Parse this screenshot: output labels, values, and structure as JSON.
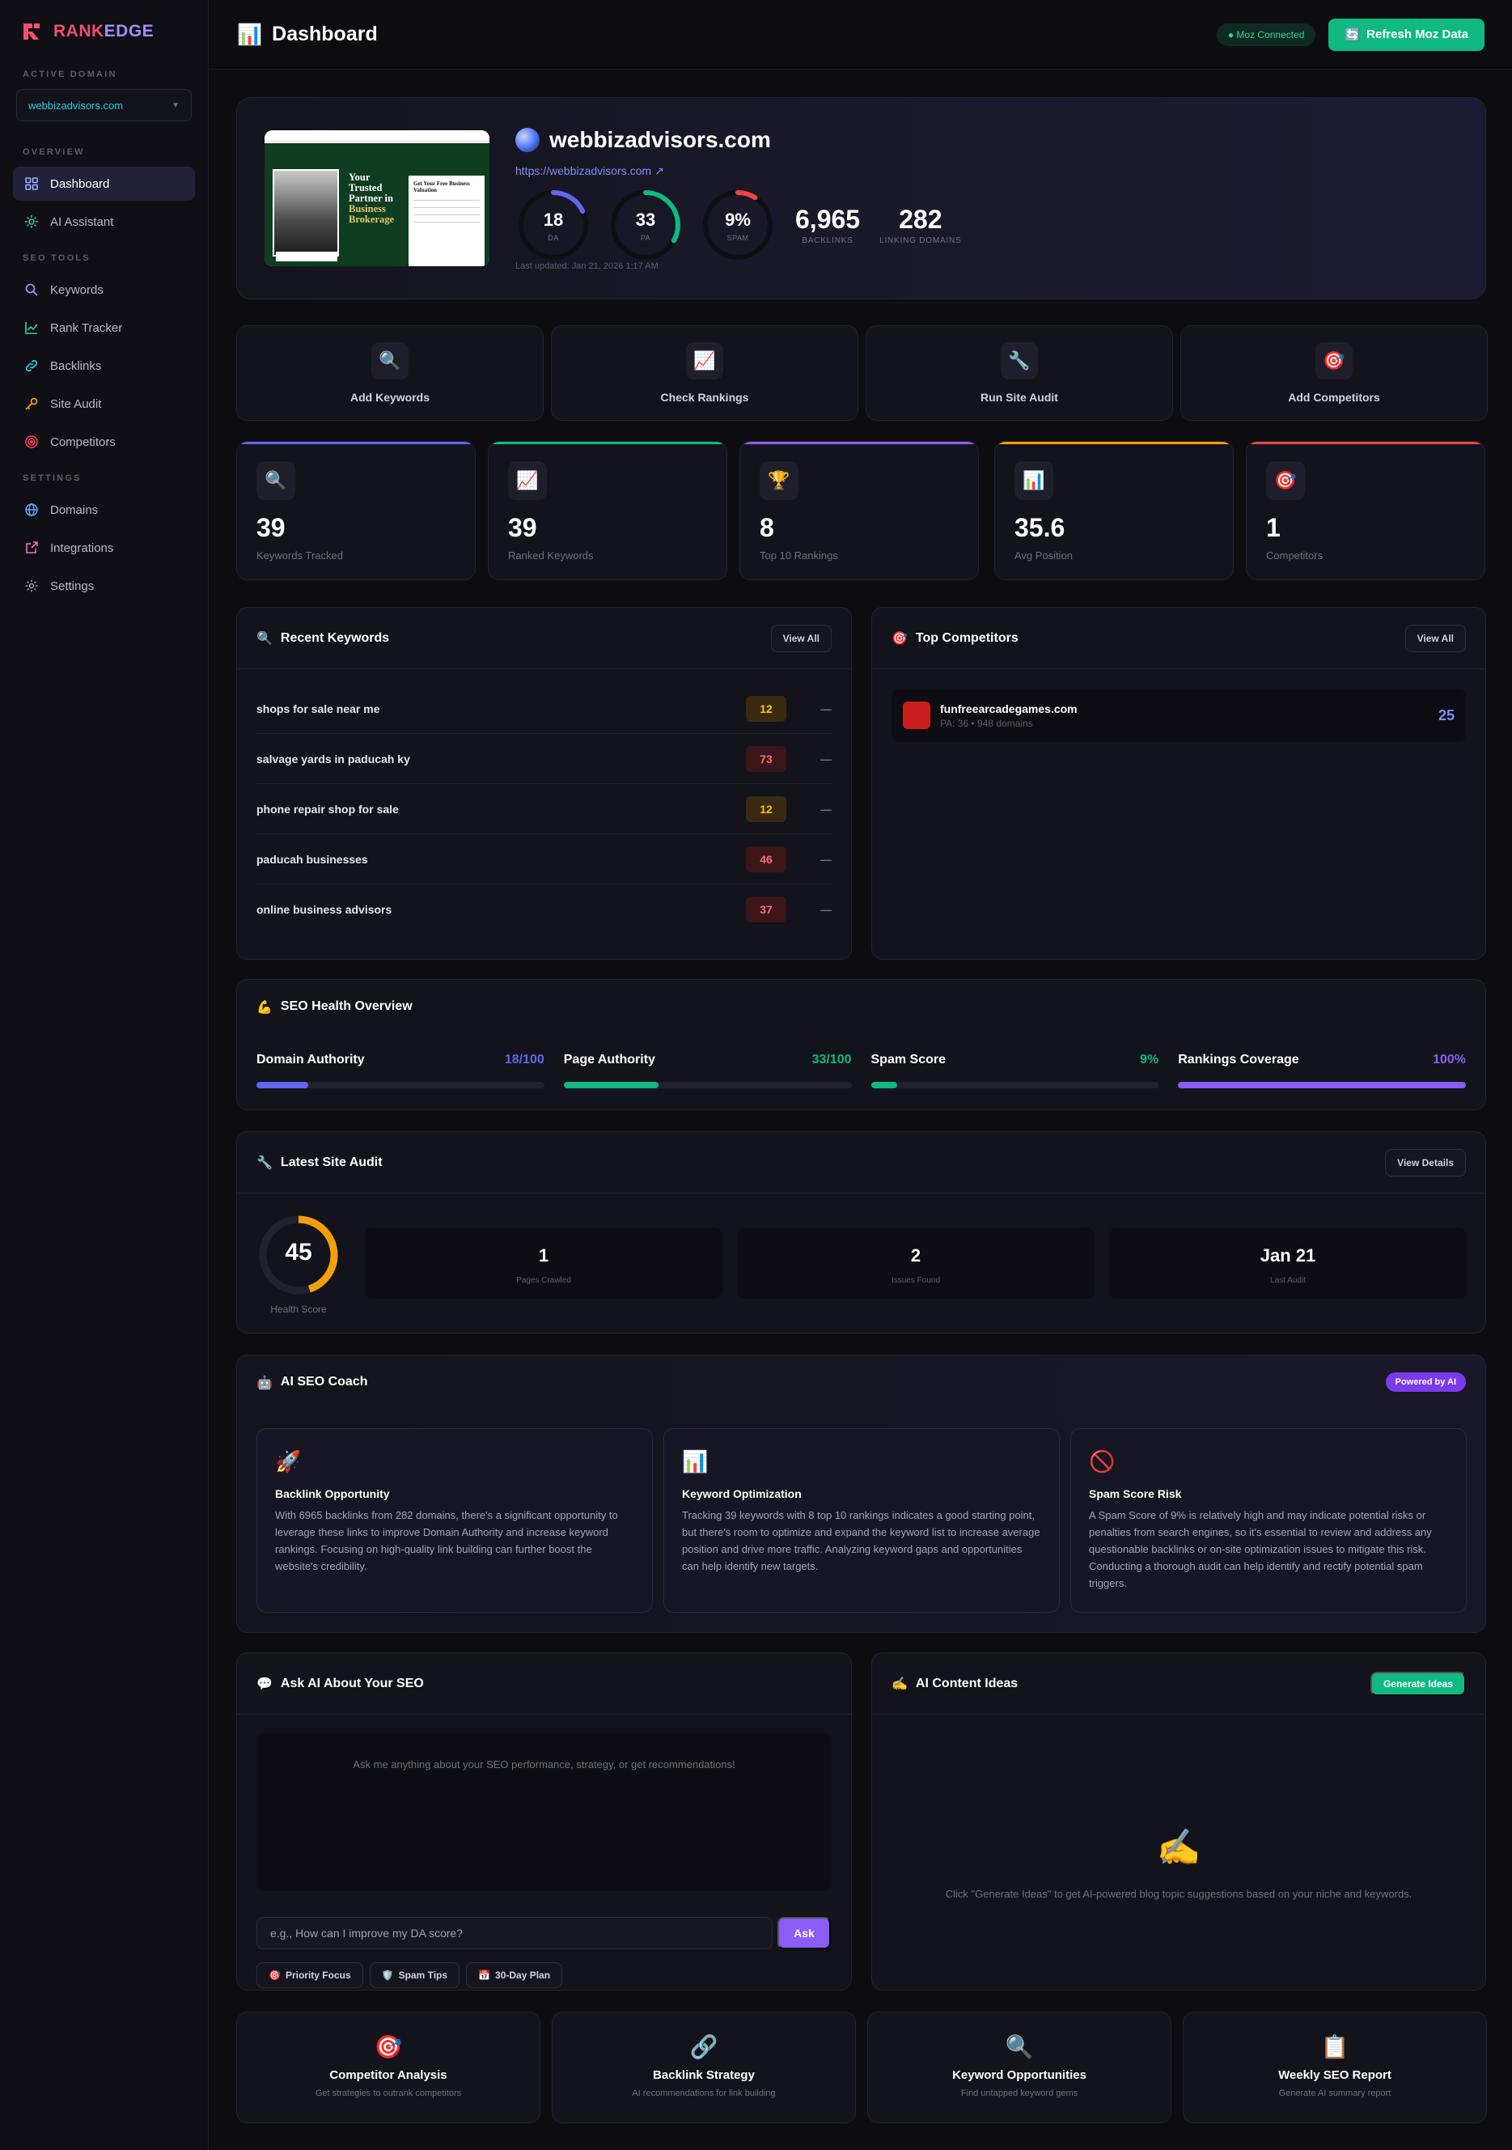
{
  "brand": {
    "part1": "RANK",
    "part2": "EDGE"
  },
  "sidebar": {
    "active_domain_label": "ACTIVE DOMAIN",
    "active_domain": "webbizadvisors.com",
    "sections": [
      {
        "label": "OVERVIEW",
        "items": [
          {
            "label": "Dashboard",
            "icon": "grid-icon",
            "active": true
          },
          {
            "label": "AI Assistant",
            "icon": "sparkle-icon"
          }
        ]
      },
      {
        "label": "SEO TOOLS",
        "items": [
          {
            "label": "Keywords",
            "icon": "search-icon"
          },
          {
            "label": "Rank Tracker",
            "icon": "trend-icon"
          },
          {
            "label": "Backlinks",
            "icon": "link-icon"
          },
          {
            "label": "Site Audit",
            "icon": "key-icon"
          },
          {
            "label": "Competitors",
            "icon": "target-icon"
          }
        ]
      },
      {
        "label": "SETTINGS",
        "items": [
          {
            "label": "Domains",
            "icon": "globe-icon"
          },
          {
            "label": "Integrations",
            "icon": "external-link-icon"
          },
          {
            "label": "Settings",
            "icon": "gear-icon"
          }
        ]
      }
    ]
  },
  "topbar": {
    "title": "Dashboard",
    "title_icon": "📊",
    "status": "● Moz Connected",
    "refresh_label": "Refresh Moz Data",
    "refresh_icon": "🔄"
  },
  "hero": {
    "domain": "webbizadvisors.com",
    "url": "https://webbizadvisors.com ↗",
    "da": {
      "value": "18",
      "label": "DA",
      "fraction": 0.18,
      "color": "#6366f1"
    },
    "pa": {
      "value": "33",
      "label": "PA",
      "fraction": 0.33,
      "color": "#10b981"
    },
    "spam": {
      "value": "9%",
      "label": "SPAM",
      "fraction": 0.09,
      "color": "#ef4444"
    },
    "backlinks": {
      "value": "6,965",
      "label": "BACKLINKS"
    },
    "linking_domains": {
      "value": "282",
      "label": "LINKING DOMAINS"
    },
    "updated": "Last updated: Jan 21, 2026 1:17 AM",
    "thumb": {
      "headline_1": "Your",
      "headline_2": "Trusted",
      "headline_3": "Partner in",
      "headline_4": "Business",
      "headline_5": "Brokerage",
      "form_title": "Get Your Free Business Valuation"
    }
  },
  "quick_actions": [
    {
      "label": "Add Keywords",
      "icon": "🔍"
    },
    {
      "label": "Check Rankings",
      "icon": "📈"
    },
    {
      "label": "Run Site Audit",
      "icon": "🔧"
    },
    {
      "label": "Add Competitors",
      "icon": "🎯"
    }
  ],
  "stats": [
    {
      "value": "39",
      "label": "Keywords Tracked",
      "icon": "🔍",
      "color": "#6366f1"
    },
    {
      "value": "39",
      "label": "Ranked Keywords",
      "icon": "📈",
      "color": "#10b981"
    },
    {
      "value": "8",
      "label": "Top 10 Rankings",
      "icon": "🏆",
      "color": "#8b5cf6"
    },
    {
      "value": "35.6",
      "label": "Avg Position",
      "icon": "📊",
      "color": "#f59e0b"
    },
    {
      "value": "1",
      "label": "Competitors",
      "icon": "🎯",
      "color": "#ef4444"
    }
  ],
  "recent_keywords": {
    "title": "Recent Keywords",
    "icon": "🔍",
    "view_all": "View All",
    "rows": [
      {
        "keyword": "shops for sale near me",
        "position": "12",
        "tone": "yellow",
        "change": "—"
      },
      {
        "keyword": "salvage yards in paducah ky",
        "position": "73",
        "tone": "red",
        "change": "—"
      },
      {
        "keyword": "phone repair shop for sale",
        "position": "12",
        "tone": "yellow",
        "change": "—"
      },
      {
        "keyword": "paducah businesses",
        "position": "46",
        "tone": "red",
        "change": "—"
      },
      {
        "keyword": "online business advisors",
        "position": "37",
        "tone": "red",
        "change": "—"
      }
    ]
  },
  "top_competitors": {
    "title": "Top Competitors",
    "icon": "🎯",
    "view_all": "View All",
    "items": [
      {
        "domain": "funfreearcadegames.com",
        "meta": "PA: 36 • 948 domains",
        "score": "25"
      }
    ]
  },
  "seo_health": {
    "title": "SEO Health Overview",
    "icon": "💪",
    "metrics": [
      {
        "label": "Domain Authority",
        "value": "18/100",
        "fraction": 0.18,
        "color": "#6366f1"
      },
      {
        "label": "Page Authority",
        "value": "33/100",
        "fraction": 0.33,
        "color": "#10b981"
      },
      {
        "label": "Spam Score",
        "value": "9%",
        "fraction": 0.09,
        "color": "#10b981"
      },
      {
        "label": "Rankings Coverage",
        "value": "100%",
        "fraction": 1.0,
        "color": "#8b5cf6"
      }
    ]
  },
  "site_audit": {
    "title": "Latest Site Audit",
    "icon": "🔧",
    "view_details": "View Details",
    "health": {
      "value": "45",
      "label": "Health Score",
      "fraction": 0.45
    },
    "boxes": [
      {
        "value": "1",
        "label": "Pages Crawled"
      },
      {
        "value": "2",
        "label": "Issues Found"
      },
      {
        "value": "Jan 21",
        "label": "Last Audit"
      }
    ]
  },
  "coach": {
    "title": "AI SEO Coach",
    "icon": "🤖",
    "badge": "Powered by AI",
    "cards": [
      {
        "icon": "🚀",
        "title": "Backlink Opportunity",
        "body": "With 6965 backlinks from 282 domains, there's a significant opportunity to leverage these links to improve Domain Authority and increase keyword rankings. Focusing on high-quality link building can further boost the website's credibility."
      },
      {
        "icon": "📊",
        "title": "Keyword Optimization",
        "body": "Tracking 39 keywords with 8 top 10 rankings indicates a good starting point, but there's room to optimize and expand the keyword list to increase average position and drive more traffic. Analyzing keyword gaps and opportunities can help identify new targets."
      },
      {
        "icon": "🚫",
        "title": "Spam Score Risk",
        "body": "A Spam Score of 9% is relatively high and may indicate potential risks or penalties from search engines, so it's essential to review and address any questionable backlinks or on-site optimization issues to mitigate this risk. Conducting a thorough audit can help identify and rectify potential spam triggers."
      }
    ]
  },
  "ask_ai": {
    "title": "Ask AI About Your SEO",
    "icon": "💬",
    "prompt_text": "Ask me anything about your SEO performance, strategy, or get recommendations!",
    "input_placeholder": "e.g., How can I improve my DA score?",
    "ask_label": "Ask",
    "chips": [
      {
        "icon": "🎯",
        "label": "Priority Focus"
      },
      {
        "icon": "🛡️",
        "label": "Spam Tips"
      },
      {
        "icon": "📅",
        "label": "30-Day Plan"
      }
    ]
  },
  "content_ideas": {
    "title": "AI Content Ideas",
    "icon": "✍️",
    "generate_label": "Generate Ideas",
    "empty_icon": "✍️",
    "empty_text": "Click \"Generate Ideas\" to get AI-powered blog topic suggestions based on your niche and keywords."
  },
  "bottom_cards": [
    {
      "icon": "🎯",
      "title": "Competitor Analysis",
      "subtitle": "Get strategies to outrank competitors"
    },
    {
      "icon": "🔗",
      "title": "Backlink Strategy",
      "subtitle": "AI recommendations for link building"
    },
    {
      "icon": "🔍",
      "title": "Keyword Opportunities",
      "subtitle": "Find untapped keyword gems"
    },
    {
      "icon": "📋",
      "title": "Weekly SEO Report",
      "subtitle": "Generate AI summary report"
    }
  ]
}
